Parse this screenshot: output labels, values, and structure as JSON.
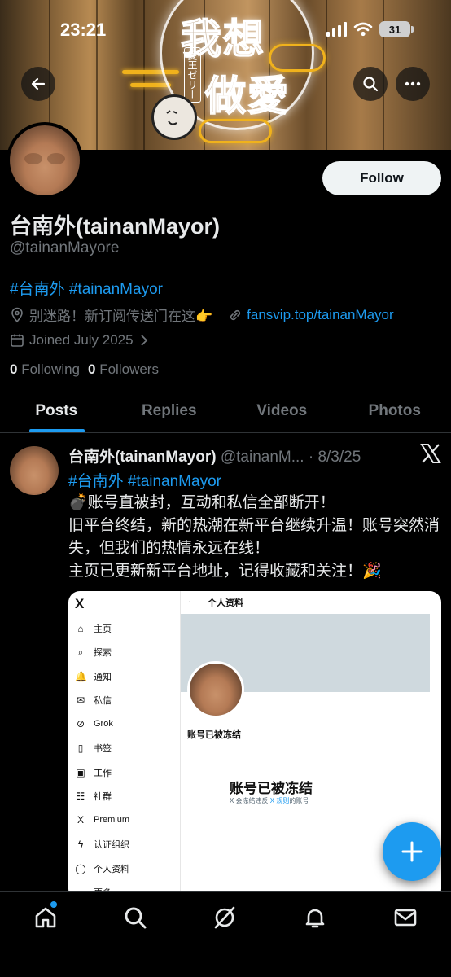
{
  "status_bar": {
    "time": "23:21",
    "battery": "31"
  },
  "banner": {
    "neon_line1": "我想",
    "neon_line2": "做愛",
    "neon_small": "愛王ゼリー"
  },
  "profile": {
    "display_name": "台南外(tainanMayor)",
    "handle": "@tainanMayore",
    "bio": "#台南外 #tainanMayor",
    "location": "别迷路！新订阅传送门在这👉",
    "website": "fansvip.top/tainanMayor",
    "joined": "Joined July 2025",
    "following_count": "0",
    "following_label": "Following",
    "followers_count": "0",
    "followers_label": "Followers",
    "follow_button": "Follow"
  },
  "tabs": [
    {
      "label": "Posts",
      "active": true
    },
    {
      "label": "Replies",
      "active": false
    },
    {
      "label": "Videos",
      "active": false
    },
    {
      "label": "Photos",
      "active": false
    }
  ],
  "tweet": {
    "name": "台南外(tainanMayor)",
    "handle": "@tainanM...",
    "date": "· 8/3/25",
    "tags": "#台南外 #tainanMayor",
    "line1": "💣账号直被封，互动和私信全部断开！",
    "line2": "旧平台终结，新的热潮在新平台继续升温！账号突然消失，但我们的热情永远在线！",
    "line3": "主页已更新新平台地址，记得收藏和关注！🎉"
  },
  "embedded_screenshot": {
    "x_logo": "X",
    "header_title": "个人资料",
    "menu": [
      {
        "icon": "⌂",
        "label": "主页"
      },
      {
        "icon": "⌕",
        "label": "探索"
      },
      {
        "icon": "🔔",
        "label": "通知"
      },
      {
        "icon": "✉",
        "label": "私信"
      },
      {
        "icon": "⊘",
        "label": "Grok"
      },
      {
        "icon": "▯",
        "label": "书签"
      },
      {
        "icon": "▣",
        "label": "工作"
      },
      {
        "icon": "☷",
        "label": "社群"
      },
      {
        "icon": "X",
        "label": "Premium"
      },
      {
        "icon": "ϟ",
        "label": "认证组织"
      },
      {
        "icon": "◯",
        "label": "个人资料"
      },
      {
        "icon": "…",
        "label": "更多"
      }
    ],
    "frozen_small": "账号已被冻结",
    "frozen_big": "账号已被冻结",
    "note_pre": "X 会冻结违反 ",
    "note_link": "X 规则",
    "note_post": "的账号"
  },
  "colors": {
    "accent": "#1d9bf0",
    "background": "#000000",
    "text": "#e7e9ea",
    "muted": "#71767b"
  }
}
